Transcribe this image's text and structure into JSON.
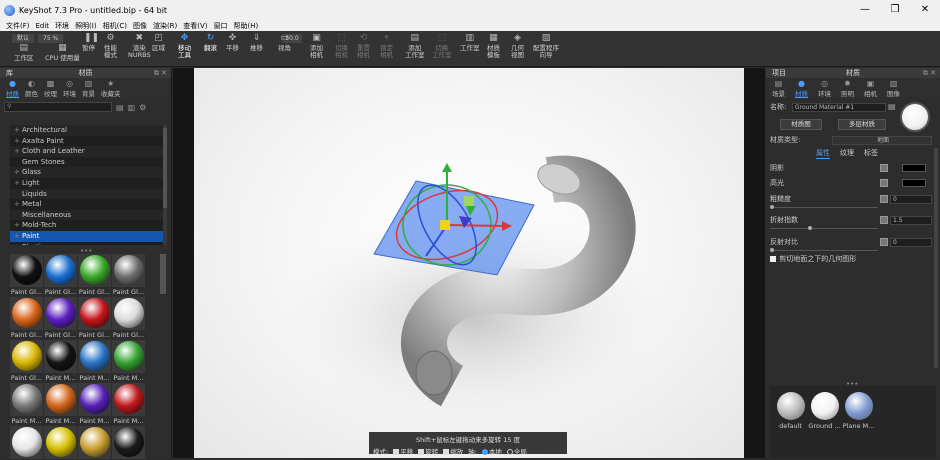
{
  "window": {
    "title": "KeyShot 7.3 Pro  - untitled.bip  - 64 bit",
    "minimize": "—",
    "maximize": "❐",
    "close": "✕"
  },
  "menu": [
    "文件(F)",
    "Edit",
    "环境",
    "照明(I)",
    "相机(C)",
    "图像",
    "渲染(R)",
    "查看(V)",
    "窗口",
    "帮助(H)"
  ],
  "ribbon": {
    "preset_1": "默认",
    "preset_2": "75 %",
    "zoom_value": "50.0",
    "tools": [
      {
        "icon": "▤",
        "label": "工作区"
      },
      {
        "icon": "▦",
        "label": "CPU 使用量"
      },
      {
        "icon": "❚❚",
        "label": "暂停"
      },
      {
        "icon": "⚙",
        "label": "性能\n模式"
      },
      {
        "icon": "✖",
        "label": "渲染\nNURBS"
      },
      {
        "icon": "◰",
        "label": "区域"
      },
      {
        "icon": "✥",
        "label": "移动\n工具"
      },
      {
        "icon": "↻",
        "label": "翻滚"
      },
      {
        "icon": "✜",
        "label": "平移"
      },
      {
        "icon": "⇓",
        "label": "推移"
      },
      {
        "icon": "▭",
        "label": "视角"
      },
      {
        "icon": "▣",
        "label": "添加\n相机"
      },
      {
        "icon": "⬚",
        "label": "切换\n相机"
      },
      {
        "icon": "⟲",
        "label": "重置\n相机"
      },
      {
        "icon": "⌖",
        "label": "锁定\n相机"
      },
      {
        "icon": "▤",
        "label": "添加\n工作室"
      },
      {
        "icon": "⬚",
        "label": "切换\n工作室"
      },
      {
        "icon": "▥",
        "label": "工作室"
      },
      {
        "icon": "▦",
        "label": "材质\n模板"
      },
      {
        "icon": "◈",
        "label": "几何\n视图"
      },
      {
        "icon": "▧",
        "label": "配置程序\n向导"
      }
    ]
  },
  "library": {
    "tab_header": "库",
    "title": "材质",
    "tabs": [
      {
        "icon": "●",
        "label": "材质"
      },
      {
        "icon": "◐",
        "label": "颜色"
      },
      {
        "icon": "▩",
        "label": "纹理"
      },
      {
        "icon": "◎",
        "label": "环境"
      },
      {
        "icon": "▨",
        "label": "背景"
      },
      {
        "icon": "★",
        "label": "收藏夹"
      }
    ],
    "search_icon": "⚲",
    "tree": [
      {
        "expander": "+",
        "label": "Architectural"
      },
      {
        "expander": "+",
        "label": "Axalta Paint"
      },
      {
        "expander": "+",
        "label": "Cloth and Leather"
      },
      {
        "expander": "",
        "label": "Gem Stones"
      },
      {
        "expander": "+",
        "label": "Glass"
      },
      {
        "expander": "+",
        "label": "Light"
      },
      {
        "expander": "",
        "label": "Liquids"
      },
      {
        "expander": "+",
        "label": "Metal"
      },
      {
        "expander": "",
        "label": "Miscellaneous"
      },
      {
        "expander": "+",
        "label": "Mold-Tech"
      },
      {
        "expander": "+",
        "label": "Paint"
      },
      {
        "expander": "+",
        "label": "Plastic"
      }
    ],
    "selected_item": "Paint",
    "materials": [
      {
        "label": "Paint Gl...",
        "color": "#111111"
      },
      {
        "label": "Paint Gl...",
        "color": "#1a6fd1"
      },
      {
        "label": "Paint Gl...",
        "color": "#3aa82a"
      },
      {
        "label": "Paint Gl...",
        "color": "#6e6e6e"
      },
      {
        "label": "Paint Gl...",
        "color": "#d8661a"
      },
      {
        "label": "Paint Gl...",
        "color": "#5b1fc0"
      },
      {
        "label": "Paint Gl...",
        "color": "#c4161c"
      },
      {
        "label": "Paint Gl...",
        "color": "#dcdcdc"
      },
      {
        "label": "Paint Gl...",
        "color": "#d9b800"
      },
      {
        "label": "Paint M...",
        "color": "#151515"
      },
      {
        "label": "Paint M...",
        "color": "#2a75c9"
      },
      {
        "label": "Paint M...",
        "color": "#37a333"
      },
      {
        "label": "Paint M...",
        "color": "#7a7a7a"
      },
      {
        "label": "Paint M...",
        "color": "#d1661b"
      },
      {
        "label": "Paint M...",
        "color": "#5621b8"
      },
      {
        "label": "Paint M...",
        "color": "#c01a1f"
      },
      {
        "label": "",
        "color": "#e6e6e6"
      },
      {
        "label": "",
        "color": "#d6c000"
      },
      {
        "label": "",
        "color": "#c9a030"
      },
      {
        "label": "",
        "color": "#1c1c1c"
      }
    ]
  },
  "hud": {
    "hint": "Shift+鼠标左键拖动来多旋转 15 度",
    "mode_label": "模式:",
    "translate": "平移",
    "rotate": "旋转",
    "scale": "缩放",
    "axis_label": "轴:",
    "local": "本地",
    "global": "全局"
  },
  "project": {
    "tab_header": "项目",
    "title": "材质",
    "tabs": [
      {
        "icon": "▤",
        "label": "场景"
      },
      {
        "icon": "●",
        "label": "材质"
      },
      {
        "icon": "◎",
        "label": "环境"
      },
      {
        "icon": "✹",
        "label": "照明"
      },
      {
        "icon": "▣",
        "label": "相机"
      },
      {
        "icon": "▨",
        "label": "图像"
      }
    ],
    "name_label": "名称:",
    "name_value": "Ground Material #1",
    "material_graph_btn": "材质图",
    "multi_material_btn": "多层材质",
    "type_label": "材质类型:",
    "type_value": "地面",
    "subtabs": [
      "属性",
      "纹理",
      "标签"
    ],
    "props": [
      {
        "label": "阴影",
        "kind": "color",
        "color": "#000000"
      },
      {
        "label": "高光",
        "kind": "color",
        "color": "#000000"
      },
      {
        "label": "粗糙度",
        "kind": "value",
        "value": "0"
      },
      {
        "label": "折射指数",
        "kind": "value",
        "value": "1.5"
      },
      {
        "label": "反射对比",
        "kind": "value",
        "value": "0"
      }
    ],
    "clip_label": "剪切地面之下的几何图形",
    "library_materials": [
      {
        "label": "default",
        "color": "#b8b8b8"
      },
      {
        "label": "Ground ...",
        "color": "#f2f2f2"
      },
      {
        "label": "Plane M...",
        "color": "#7d97cf"
      }
    ]
  }
}
